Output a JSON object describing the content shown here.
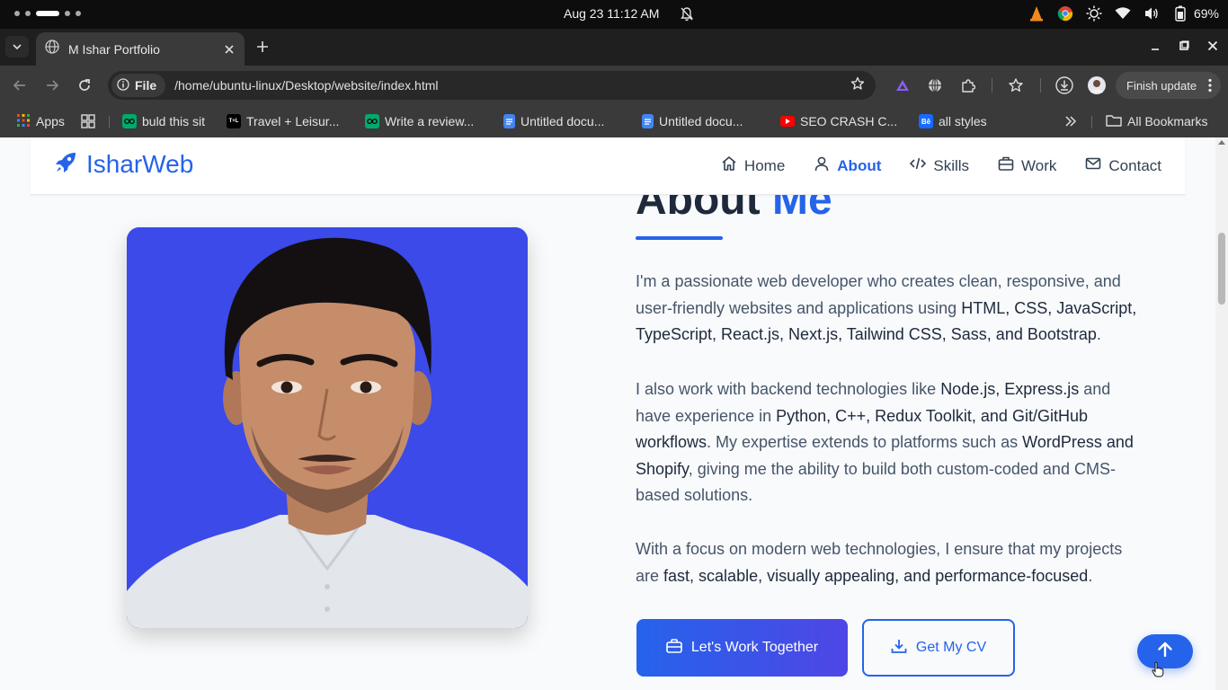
{
  "os": {
    "clock": "Aug 23  11:12 AM",
    "battery": "69%"
  },
  "browser": {
    "tab_title": "M Ishar Portfolio",
    "url_scheme": "File",
    "url": "/home/ubuntu-linux/Desktop/website/index.html",
    "finish_update_label": "Finish update",
    "bookmarks": [
      {
        "label": "Apps",
        "icon": "apps-grid-icon",
        "color": "#ea4335"
      },
      {
        "label": "buld this sit",
        "icon": "tripadvisor-icon",
        "color": "#00aa6c"
      },
      {
        "label": "Travel + Leisur...",
        "icon": "travel-leisure-icon",
        "color": "#000000"
      },
      {
        "label": "Write a review...",
        "icon": "tripadvisor-icon",
        "color": "#00aa6c"
      },
      {
        "label": "Untitled docu...",
        "icon": "google-docs-icon",
        "color": "#4285f4"
      },
      {
        "label": "Untitled docu...",
        "icon": "google-docs-icon",
        "color": "#4285f4"
      },
      {
        "label": "SEO CRASH C...",
        "icon": "youtube-icon",
        "color": "#ff0000"
      },
      {
        "label": "all styles",
        "icon": "behance-icon",
        "color": "#1769ff"
      }
    ],
    "all_bookmarks_label": "All Bookmarks"
  },
  "site": {
    "brand": "IsharWeb",
    "nav": [
      {
        "label": "Home",
        "icon": "home-icon",
        "active": false
      },
      {
        "label": "About",
        "icon": "user-icon",
        "active": true
      },
      {
        "label": "Skills",
        "icon": "code-icon",
        "active": false
      },
      {
        "label": "Work",
        "icon": "briefcase-icon",
        "active": false
      },
      {
        "label": "Contact",
        "icon": "mail-icon",
        "active": false
      }
    ],
    "about": {
      "heading_main": "About",
      "heading_accent": "Me",
      "para1": {
        "t1": "I'm a passionate web developer who creates clean, responsive, and user-friendly websites and applications using ",
        "b1": "HTML, CSS, JavaScript, TypeScript, React.js, Next.js, Tailwind CSS, Sass, and Bootstrap",
        "t2": "."
      },
      "para2": {
        "t1": "I also work with backend technologies like ",
        "b1": "Node.js, Express.js",
        "t2": " and have experience in ",
        "b2": "Python, C++, Redux Toolkit, and Git/GitHub workflows",
        "t3": ". My expertise extends to platforms such as ",
        "b3": "WordPress and Shopify",
        "t4": ", giving me the ability to build both custom-coded and CMS-based solutions."
      },
      "para3": {
        "t1": "With a focus on modern web technologies, I ensure that my projects are ",
        "b1": "fast, scalable, visually appealing, and performance-focused",
        "t2": "."
      },
      "cta_primary": "Let's Work Together",
      "cta_secondary": "Get My CV"
    },
    "colors": {
      "accent": "#2563eb",
      "photo_bg": "#3b4ae8"
    }
  }
}
